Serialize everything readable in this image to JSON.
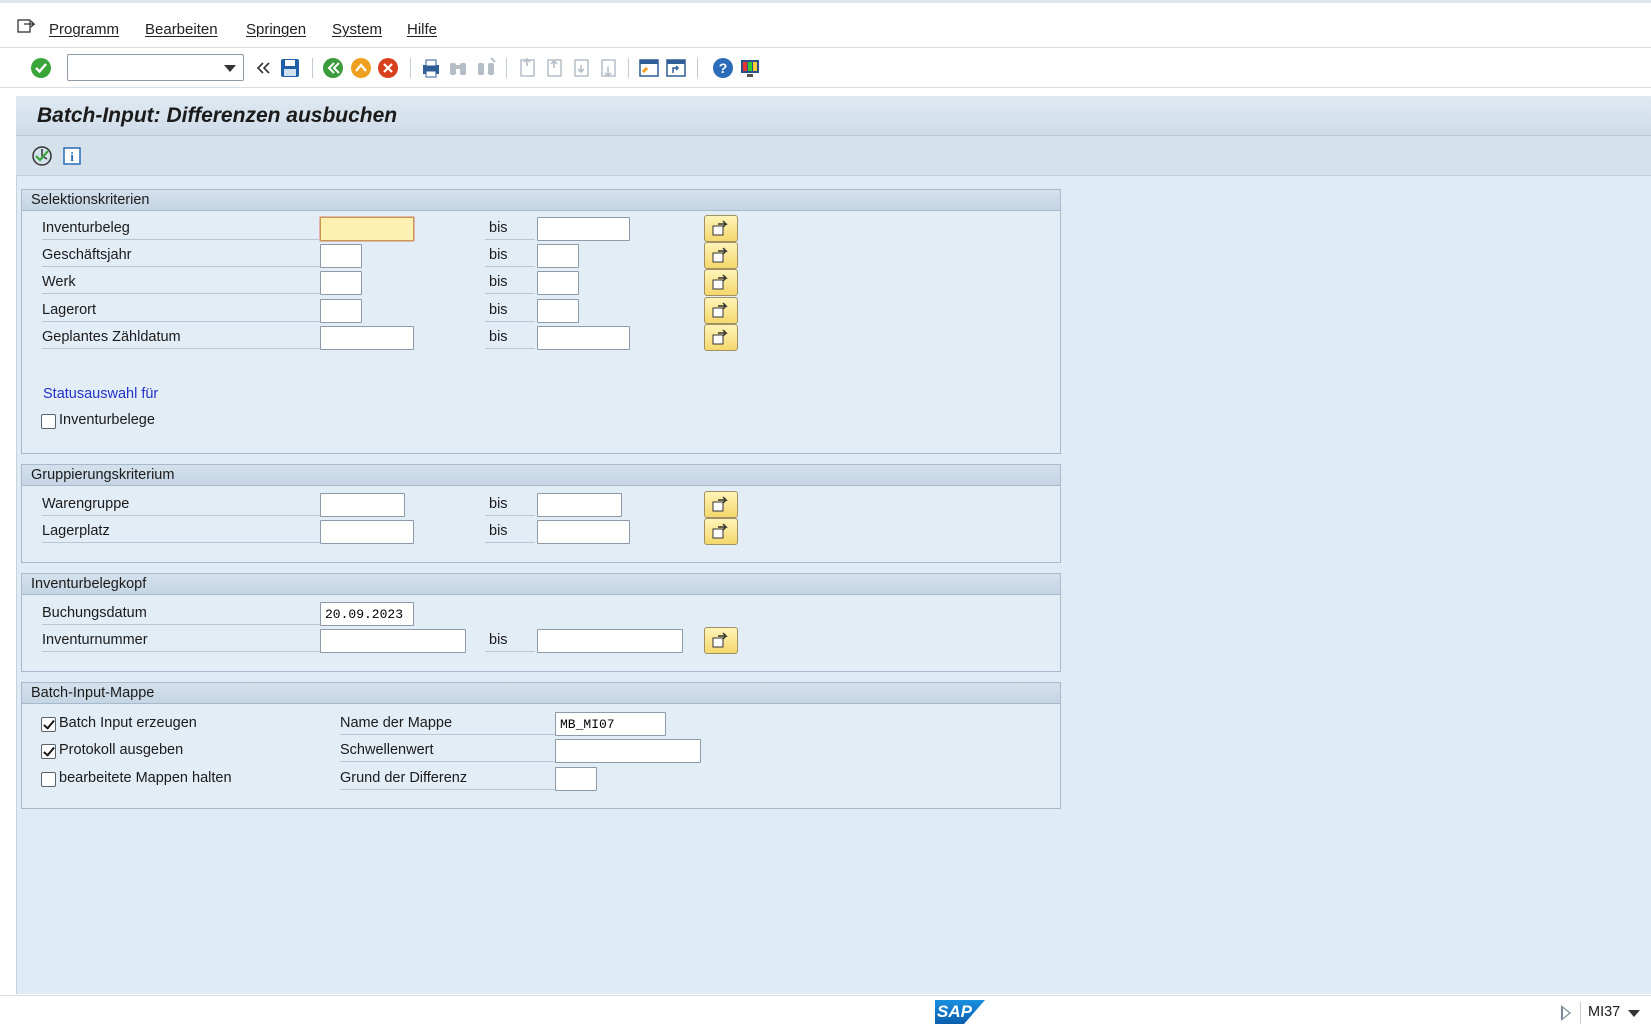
{
  "menubar": {
    "items": [
      "Programm",
      "Bearbeiten",
      "Springen",
      "System",
      "Hilfe"
    ]
  },
  "toolbar": {
    "command_field_value": ""
  },
  "title": "Batch-Input: Differenzen ausbuchen",
  "groups": {
    "selection": {
      "header": "Selektionskriterien",
      "rows": [
        {
          "label": "Inventurbeleg",
          "from": "",
          "to": ""
        },
        {
          "label": "Geschäftsjahr",
          "from": "",
          "to": ""
        },
        {
          "label": "Werk",
          "from": "",
          "to": ""
        },
        {
          "label": "Lagerort",
          "from": "",
          "to": ""
        },
        {
          "label": "Geplantes Zähldatum",
          "from": "",
          "to": ""
        }
      ],
      "bis": "bis",
      "status_title": "Statusauswahl für",
      "status_checkbox_label": "Inventurbelege",
      "status_checkbox_checked": false
    },
    "grouping": {
      "header": "Gruppierungskriterium",
      "rows": [
        {
          "label": "Warengruppe",
          "from": "",
          "to": ""
        },
        {
          "label": "Lagerplatz",
          "from": "",
          "to": ""
        }
      ]
    },
    "header_data": {
      "header": "Inventurbelegkopf",
      "posting_date_label": "Buchungsdatum",
      "posting_date_value": "20.09.2023",
      "inventory_number_label": "Inventurnummer",
      "inventory_number_from": "",
      "inventory_number_to": ""
    },
    "batch": {
      "header": "Batch-Input-Mappe",
      "checkboxes": [
        {
          "label": "Batch Input erzeugen",
          "checked": true
        },
        {
          "label": "Protokoll ausgeben",
          "checked": true
        },
        {
          "label": "bearbeitete Mappen halten",
          "checked": false
        }
      ],
      "session_name_label": "Name der Mappe",
      "session_name_value": "MB_MI07",
      "threshold_label": "Schwellenwert",
      "threshold_value": "",
      "reason_label": "Grund der Differenz",
      "reason_value": ""
    }
  },
  "statusbar": {
    "logo": "SAP",
    "transaction": "MI37"
  },
  "colors": {
    "screen_bg": "#dfebf5",
    "accent_blue": "#2332c9",
    "multi_button": "#f4d86c"
  }
}
